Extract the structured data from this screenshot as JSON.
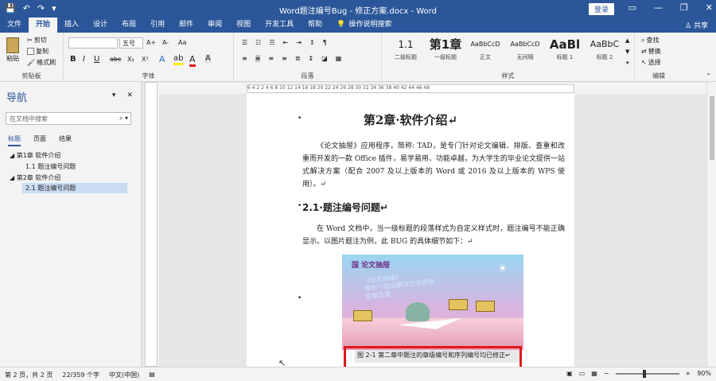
{
  "titlebar": {
    "title": "Word题注编号Bug - 修正方案.docx - Word",
    "login": "登录",
    "save": "💾",
    "undo": "↶",
    "redo": "↷",
    "customize": "▾"
  },
  "tabs": [
    "文件",
    "开始",
    "插入",
    "设计",
    "布局",
    "引用",
    "邮件",
    "审阅",
    "视图",
    "开发工具",
    "帮助"
  ],
  "help_search": "操作说明搜索",
  "help_icon": "💡",
  "share": "共享",
  "ribbon": {
    "clipboard": {
      "paste": "粘贴",
      "cut": "剪切",
      "copy": "复制",
      "format_painter": "格式刷",
      "label": "剪贴板"
    },
    "font": {
      "name": "",
      "size": "五号",
      "label": "字体",
      "grow": "A+",
      "shrink": "A-",
      "case": "Aa",
      "bold": "B",
      "italic": "I",
      "underline": "U",
      "strike": "abc",
      "sub": "X₂",
      "sup": "X²"
    },
    "paragraph": {
      "label": "段落"
    },
    "styles": {
      "label": "样式",
      "items": [
        {
          "sample": "1.1",
          "name": "二级标题"
        },
        {
          "sample": "第1章",
          "name": "一级标题"
        },
        {
          "sample": "AaBbCcD",
          "name": "正文"
        },
        {
          "sample": "AaBbCcD",
          "name": "无间隔"
        },
        {
          "sample": "AaBl",
          "name": "标题 1"
        },
        {
          "sample": "AaBbC",
          "name": "标题 2"
        }
      ]
    },
    "editing": {
      "find": "查找",
      "replace": "替换",
      "select": "选择",
      "label": "编辑"
    }
  },
  "nav": {
    "title": "导航",
    "search_placeholder": "在文档中搜索",
    "tabs": [
      "标题",
      "页面",
      "结果"
    ],
    "items": [
      {
        "label": "第1章 软件介绍"
      },
      {
        "label": "1.1 题注编号问题"
      },
      {
        "label": "第2章 软件介绍"
      },
      {
        "label": "2.1 题注编号问题"
      }
    ]
  },
  "ruler": {
    "ticks": "6  4  2     2  4  6  8  10  12  14  16  18  20  22  24  26  28  30  32  34  36  38  40  42  44  46  48"
  },
  "document": {
    "heading1": "第2章·软件介绍↵",
    "para1": "《论文抽屉》应用程序，简称: TAD，是专门针对论文编辑、排版、查重和改重而开发的一款 Office 插件，易学易用、功能卓越，为大学生的毕业论文提供一站式解决方案（配合 2007 及以上版本的 Word 或 2016 及以上版本的 WPS 使用）。↵",
    "heading2": "2.1·题注编号问题↵",
    "para2": "在 Word 文档中，当一级标题的段落样式为自定义样式时，题注编号不能正确显示。以图片题注为例，此 BUG 的具体细节如下：↵",
    "picture_logo": "国 论文抽屉",
    "picture_text": "《论文抽屉》\n帮你一站式解决论文排版\n查重改重",
    "caption": "图 2-1 第二章中题注的章级编号和序列编号均已修正↵",
    "bullet": "•"
  },
  "status": {
    "page": "第 2 页，共 2 页",
    "words": "22/359 个字",
    "lang": "中文(中国)",
    "zoom": "90%"
  },
  "colors": {
    "brand": "#2b579a",
    "highlight": "#e0181c"
  }
}
